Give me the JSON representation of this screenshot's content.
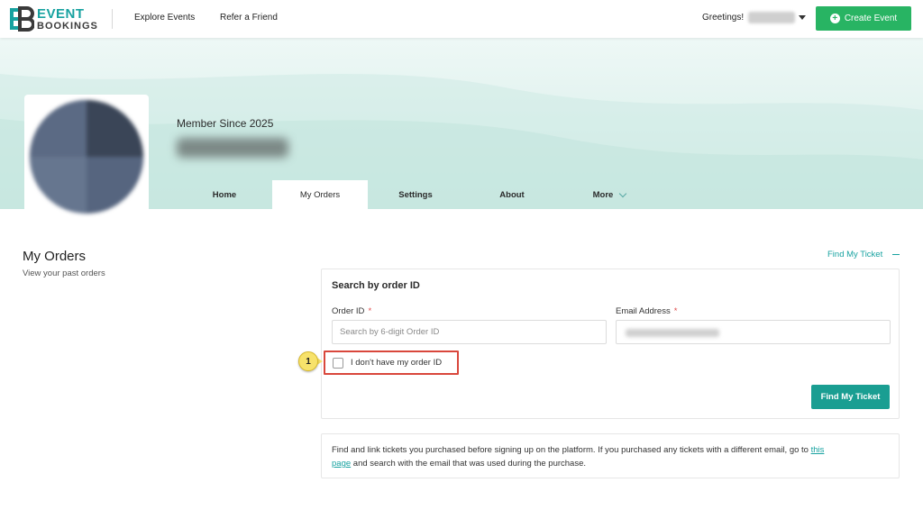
{
  "header": {
    "logo_line1": "EVENT",
    "logo_line2": "BOOKINGS",
    "nav": [
      {
        "label": "Explore Events"
      },
      {
        "label": "Refer a Friend"
      }
    ],
    "greeting": "Greetings!",
    "create_button": "Create Event",
    "create_button_color": "#28b463"
  },
  "profile": {
    "member_since": "Member Since 2025"
  },
  "tabs": [
    {
      "label": "Home",
      "active": false
    },
    {
      "label": "My Orders",
      "active": true
    },
    {
      "label": "Settings",
      "active": false
    },
    {
      "label": "About",
      "active": false
    },
    {
      "label": "More",
      "active": false
    }
  ],
  "section": {
    "title": "My Orders",
    "subtitle": "View your past orders",
    "find_ticket_link": "Find My Ticket"
  },
  "search_card": {
    "title": "Search by order ID",
    "order_id_label": "Order ID",
    "order_id_placeholder": "Search by 6-digit Order ID",
    "email_label": "Email Address",
    "required_mark": "*",
    "checkbox_label": "I don't have my order ID",
    "checkbox_checked": false,
    "find_button": "Find My Ticket",
    "callout_number": "1"
  },
  "info": {
    "text_before": "Find and link tickets you purchased before signing up on the platform. If you purchased any tickets with a different email, go to ",
    "link1": "this",
    "link2": "page",
    "text_after": " and search with the email that was used during the purchase."
  },
  "colors": {
    "accent": "#17a2a0",
    "button_teal": "#1a9e92",
    "highlight_border": "#d9473c",
    "callout": "#f7e26b"
  }
}
